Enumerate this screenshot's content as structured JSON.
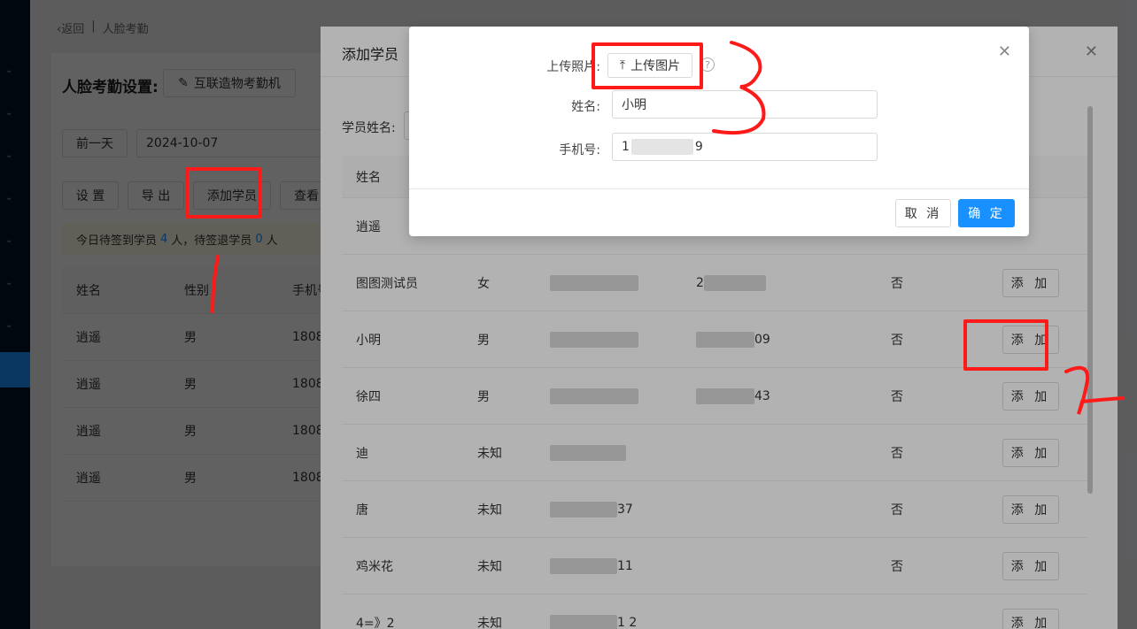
{
  "breadcrumb": {
    "back": "返回",
    "sep": "|",
    "current": "人脸考勤"
  },
  "settings": {
    "title": "人脸考勤设置:",
    "iot_button": "互联造物考勤机",
    "prev_day": "前一天",
    "date": "2024-10-07",
    "toolbar": [
      "设 置",
      "导 出",
      "添加学员",
      "查看"
    ]
  },
  "notice": {
    "prefix": "今日待签到学员",
    "count1": "4",
    "mid": "人，待签退学员",
    "count2": "0",
    "suffix": "人"
  },
  "base_table": {
    "headers": [
      "姓名",
      "性别",
      "手机号"
    ],
    "rows": [
      [
        "逍遥",
        "男",
        "1808"
      ],
      [
        "逍遥",
        "男",
        "1808"
      ],
      [
        "逍遥",
        "男",
        "1808"
      ],
      [
        "逍遥",
        "男",
        "1808"
      ]
    ]
  },
  "drawer": {
    "title": "添加学员",
    "search_label": "学员姓名:",
    "header_name": "姓名",
    "rows": [
      {
        "name": "逍遥",
        "gender": "",
        "phone_tail": "",
        "extra": "",
        "flag": "",
        "action": ""
      },
      {
        "name": "图图测试员",
        "gender": "女",
        "phone_tail": "",
        "extra": "2",
        "flag": "否",
        "action": "添 加"
      },
      {
        "name": "小明",
        "gender": "男",
        "phone_tail": "",
        "extra": "09",
        "flag": "否",
        "action": "添 加"
      },
      {
        "name": "徐四",
        "gender": "男",
        "phone_tail": "",
        "extra": "43",
        "flag": "否",
        "action": "添 加"
      },
      {
        "name": "迪",
        "gender": "未知",
        "phone_tail": "",
        "extra": "",
        "flag": "否",
        "action": "添 加"
      },
      {
        "name": "唐",
        "gender": "未知",
        "phone_tail": "37",
        "extra": "",
        "flag": "否",
        "action": "添 加"
      },
      {
        "name": "鸡米花",
        "gender": "未知",
        "phone_tail": "11",
        "extra": "",
        "flag": "否",
        "action": "添 加"
      },
      {
        "name": "4=》2",
        "gender": "未知",
        "phone_tail": "1 2",
        "extra": "",
        "flag": "",
        "action": "添 加"
      }
    ]
  },
  "modal": {
    "upload_label": "上传照片:",
    "upload_button": "上传图片",
    "help": "?",
    "name_label": "姓名:",
    "name_value": "小明",
    "phone_label": "手机号:",
    "phone_value_start": "1",
    "phone_value_end": "9",
    "cancel": "取 消",
    "confirm": "确 定"
  },
  "colors": {
    "primary": "#1890ff",
    "annotation": "#ff1a1a",
    "sidebar": "#001529"
  },
  "icons": [
    "chevron-left-icon",
    "edit-icon",
    "calendar-icon",
    "upload-icon",
    "close-icon",
    "question-icon"
  ]
}
